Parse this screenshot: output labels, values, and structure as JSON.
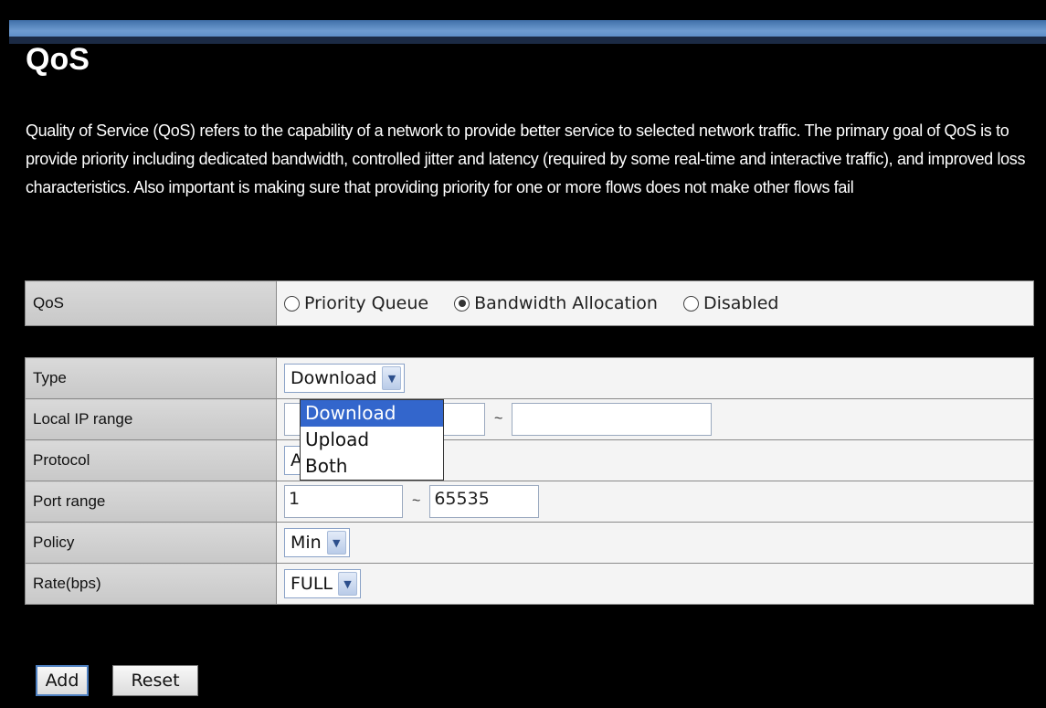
{
  "page": {
    "title": "QoS",
    "description": "Quality of Service (QoS) refers to the capability of a network to provide better service to selected network traffic. The primary goal of QoS is to provide priority including dedicated bandwidth, controlled jitter and latency (required by some real-time and interactive traffic), and improved loss characteristics. Also important is making sure that providing priority for one or more flows does not make other flows fail"
  },
  "qos": {
    "label": "QoS",
    "options": [
      "Priority Queue",
      "Bandwidth Allocation",
      "Disabled"
    ],
    "selected": "Bandwidth Allocation"
  },
  "form": {
    "type_label": "Type",
    "type_value": "Download",
    "type_options": [
      "Download",
      "Upload",
      "Both"
    ],
    "local_ip_label": "Local IP range",
    "local_ip_start": "",
    "local_ip_end": "",
    "protocol_label": "Protocol",
    "protocol_value": "ALL",
    "port_label": "Port range",
    "port_start": "1",
    "port_end": "65535",
    "policy_label": "Policy",
    "policy_value": "Min",
    "rate_label": "Rate(bps)",
    "rate_value": "FULL",
    "range_separator": "~"
  },
  "buttons": {
    "add": "Add",
    "reset": "Reset"
  },
  "colors": {
    "background": "#000000",
    "banner": "#4d7fbf",
    "dropdown_highlight": "#3366cc"
  }
}
